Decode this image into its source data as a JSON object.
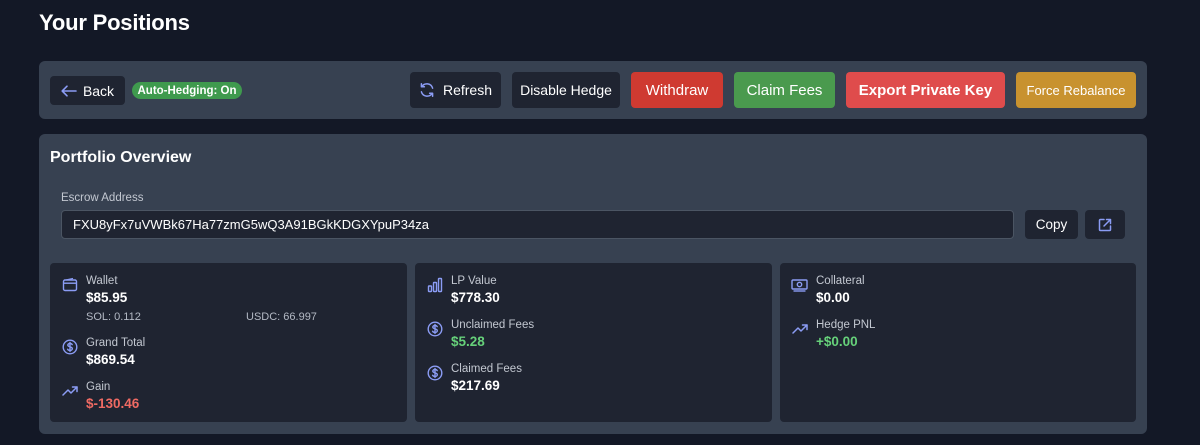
{
  "page": {
    "title": "Your Positions"
  },
  "toolbar": {
    "back_label": "Back",
    "hedging_badge": "Auto-Hedging: On",
    "refresh_label": "Refresh",
    "disable_hedge_label": "Disable Hedge",
    "withdraw_label": "Withdraw",
    "claim_fees_label": "Claim Fees",
    "export_key_label": "Export Private Key",
    "force_rebalance_label": "Force Rebalance"
  },
  "portfolio": {
    "title": "Portfolio Overview",
    "escrow_label": "Escrow Address",
    "escrow_address": "FXU8yFx7uVWBk67Ha77zmG5wQ3A91BGkKDGXYpuP34za",
    "copy_label": "Copy",
    "cards": {
      "wallet": {
        "label": "Wallet",
        "value": "$85.95",
        "sol": "SOL: 0.112",
        "usdc": "USDC: 66.997",
        "grand_total_label": "Grand Total",
        "grand_total_value": "$869.54",
        "gain_label": "Gain",
        "gain_value": "$-130.46"
      },
      "lp": {
        "label": "LP Value",
        "value": "$778.30",
        "unclaimed_label": "Unclaimed Fees",
        "unclaimed_value": "$5.28",
        "claimed_label": "Claimed Fees",
        "claimed_value": "$217.69"
      },
      "collateral": {
        "label": "Collateral",
        "value": "$0.00",
        "hedge_pnl_label": "Hedge PNL",
        "hedge_pnl_value": "+$0.00"
      }
    }
  },
  "colors": {
    "background": "#131826",
    "panel": "#374151",
    "card": "#1f2431",
    "icon_accent": "#8b9cf4",
    "positive": "#66d17a",
    "negative": "#ef6a63",
    "withdraw": "#cf3a31",
    "claim": "#4a9a4e",
    "export": "#df4c4c",
    "force": "#c8922f"
  },
  "icons": {
    "back": "arrow-left-icon",
    "refresh": "refresh-icon",
    "external": "external-link-icon",
    "wallet": "wallet-icon",
    "dollar": "dollar-circle-icon",
    "trend": "trending-up-icon",
    "bars": "bar-chart-icon",
    "cash": "banknote-icon"
  }
}
